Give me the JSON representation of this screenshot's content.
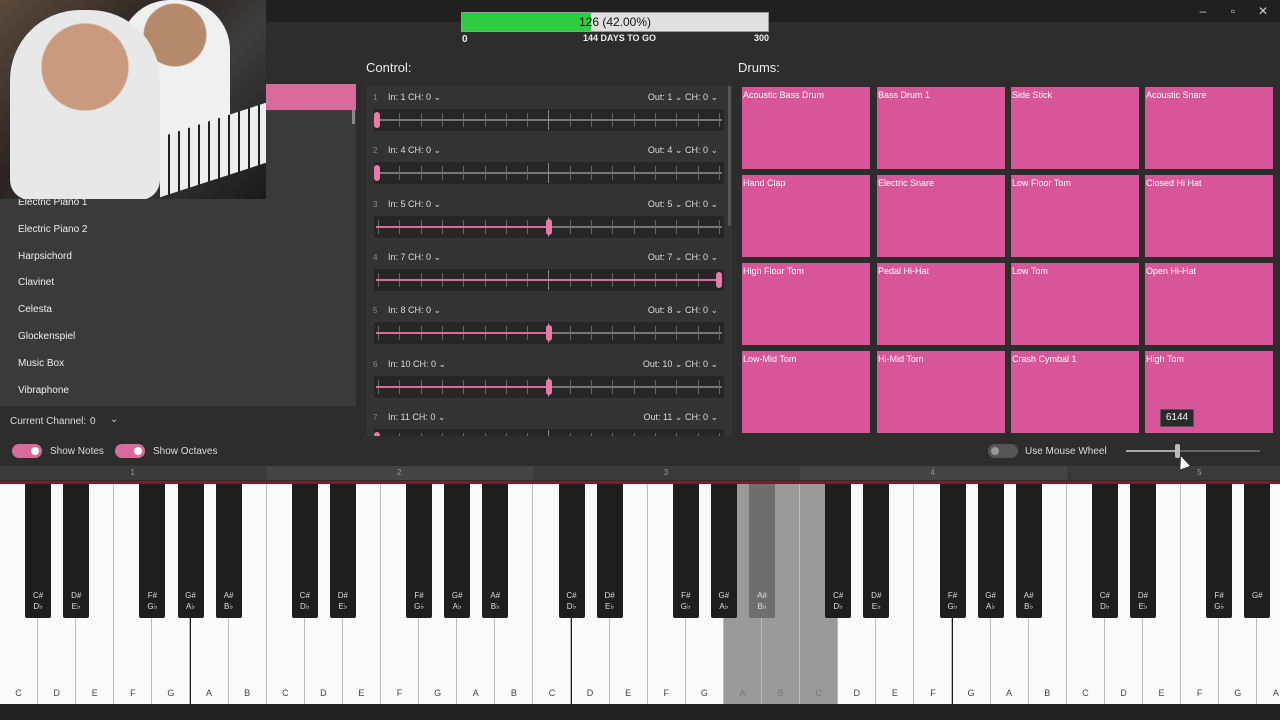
{
  "window": {
    "minimize": "–",
    "maximize": "▫",
    "close": "✕"
  },
  "progress": {
    "text": "126 (42.00%)",
    "percent": 42,
    "start": "0",
    "end": "300",
    "days_to_go": "144 DAYS TO GO"
  },
  "instruments": {
    "items": [
      "Electric Piano 1",
      "Electric Piano 2",
      "Harpsichord",
      "Clavinet",
      "Celesta",
      "Glockenspiel",
      "Music Box",
      "Vibraphone"
    ],
    "current_channel_label": "Current Channel:",
    "current_channel_value": "0"
  },
  "control": {
    "title": "Control:",
    "rows": [
      {
        "num": "1",
        "in": "In: 1  CH: 0",
        "out": "Out:   1  ⌄   CH:   0  ⌄",
        "level": 0.0
      },
      {
        "num": "2",
        "in": "In: 4  CH: 0",
        "out": "Out:   4  ⌄   CH:   0  ⌄",
        "level": 0.0
      },
      {
        "num": "3",
        "in": "In: 5  CH: 0",
        "out": "Out:   5  ⌄   CH:   0  ⌄",
        "level": 0.5
      },
      {
        "num": "4",
        "in": "In: 7  CH: 0",
        "out": "Out:   7  ⌄   CH:   0  ⌄",
        "level": 1.0
      },
      {
        "num": "5",
        "in": "In: 8  CH: 0",
        "out": "Out:   8  ⌄   CH:   0  ⌄",
        "level": 0.5
      },
      {
        "num": "6",
        "in": "In: 10  CH: 0",
        "out": "Out:   10  ⌄   CH:   0  ⌄",
        "level": 0.5
      },
      {
        "num": "7",
        "in": "In: 11  CH: 0",
        "out": "Out:   11  ⌄   CH:   0  ⌄",
        "level": 0.0
      }
    ]
  },
  "drums": {
    "title": "Drums:",
    "pads": [
      "Acoustic Bass Drum",
      "Bass Drum 1",
      "Side Stick",
      "Acoustic Snare",
      "Hand Clap",
      "Electric Snare",
      "Low Floor Tom",
      "Closed Hi Hat",
      "High Floor Tom",
      "Pedal Hi-Hat",
      "Low Tom",
      "Open Hi-Hat",
      "Low-Mid Tom",
      "Hi-Mid Tom",
      "Crash Cymbal 1",
      "High Tom"
    ],
    "tooltip": "6144"
  },
  "toggles": {
    "show_notes": "Show Notes",
    "show_octaves": "Show Octaves",
    "use_mouse_wheel": "Use Mouse Wheel"
  },
  "octaves": [
    "1",
    "2",
    "3",
    "4",
    "5"
  ],
  "piano": {
    "white_notes": [
      "C",
      "D",
      "E",
      "F",
      "G",
      "A",
      "B",
      "C",
      "D",
      "E",
      "F",
      "G",
      "A",
      "B",
      "C",
      "D",
      "E",
      "F",
      "G",
      "A",
      "B",
      "C",
      "D",
      "E",
      "F",
      "G",
      "A",
      "B",
      "C",
      "D",
      "E",
      "F",
      "G",
      "A"
    ],
    "black_notes": [
      [
        "C#",
        "D♭"
      ],
      [
        "D#",
        "E♭"
      ],
      [
        "F#",
        "G♭"
      ],
      [
        "G#",
        "A♭"
      ],
      [
        "A#",
        "B♭"
      ],
      [
        "C#",
        "D♭"
      ],
      [
        "D#",
        "E♭"
      ],
      [
        "F#",
        "G♭"
      ],
      [
        "G#",
        "A♭"
      ],
      [
        "A#",
        "B♭"
      ],
      [
        "C#",
        "D♭"
      ],
      [
        "D#",
        "E♭"
      ],
      [
        "F#",
        "G♭"
      ],
      [
        "G#",
        "A♭"
      ],
      [
        "A#",
        "B♭"
      ],
      [
        "C#",
        "D♭"
      ],
      [
        "D#",
        "E♭"
      ],
      [
        "F#",
        "G♭"
      ],
      [
        "G#",
        "A♭"
      ],
      [
        "A#",
        "B♭"
      ],
      [
        "C#",
        "D♭"
      ],
      [
        "D#",
        "E♭"
      ],
      [
        "F#",
        "G♭"
      ],
      [
        "G#"
      ]
    ]
  }
}
